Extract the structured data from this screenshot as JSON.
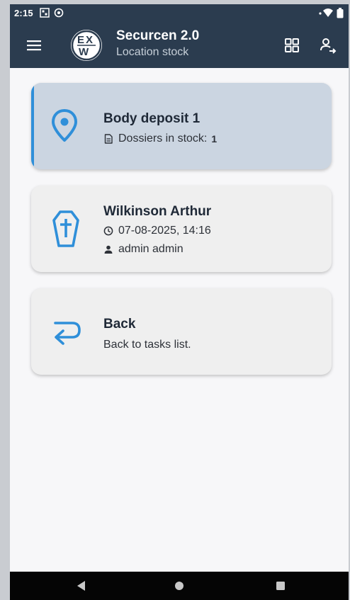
{
  "status_bar": {
    "time": "2:15"
  },
  "app_bar": {
    "title": "Securcen 2.0",
    "subtitle": "Location stock",
    "logo_letters": {
      "top_left": "E",
      "top_right": "X",
      "bottom": "W"
    }
  },
  "cards": [
    {
      "title": "Body deposit 1",
      "line1_label": "Dossiers in stock:",
      "line1_count": "1",
      "icon": "location-pin-icon"
    },
    {
      "title": "Wilkinson Arthur",
      "datetime": "07-08-2025, 14:16",
      "user": "admin admin",
      "icon": "coffin-icon"
    },
    {
      "title": "Back",
      "description": "Back to tasks list.",
      "icon": "back-arrow-icon"
    }
  ],
  "colors": {
    "app_bar": "#2b3c4f",
    "accent": "#2f8fd9",
    "active_card": "#cbd5e1",
    "card": "#efefef"
  }
}
